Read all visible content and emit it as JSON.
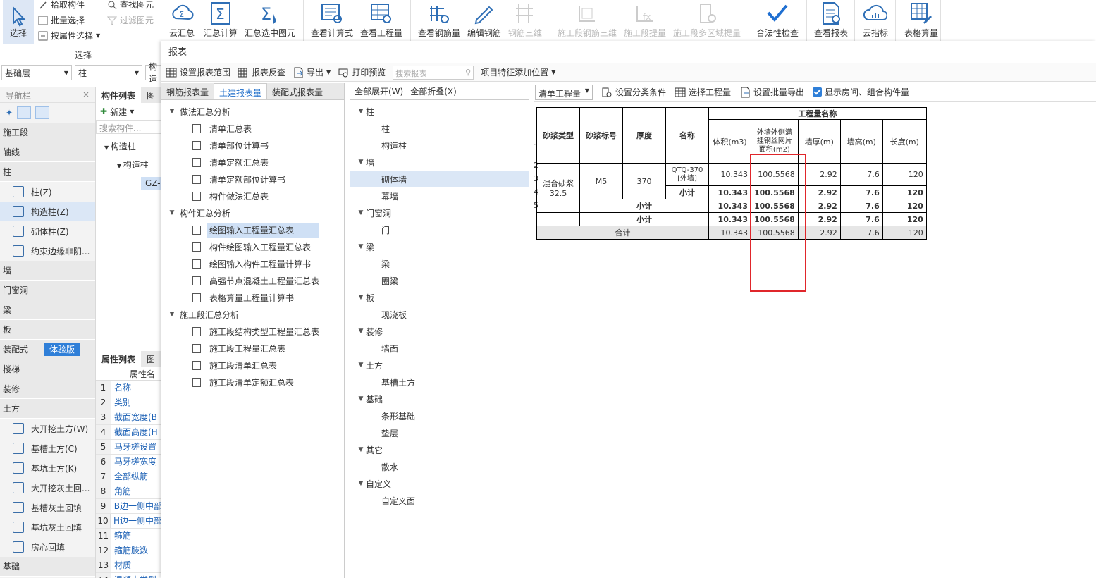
{
  "ribbon": {
    "select": {
      "label": "选择",
      "pick": "拾取构件",
      "batch": "批量选择",
      "attr": "按属性选择",
      "find": "查找图元",
      "filter": "过滤图元",
      "group": "选择"
    },
    "buttons": [
      {
        "label": "云汇总",
        "disabled": false
      },
      {
        "label": "汇总计算",
        "disabled": false
      },
      {
        "label": "汇总选中图元",
        "disabled": false
      },
      {
        "label": "查看计算式",
        "disabled": false
      },
      {
        "label": "查看工程量",
        "disabled": false
      },
      {
        "label": "查看钢筋量",
        "disabled": false
      },
      {
        "label": "编辑钢筋",
        "disabled": false
      },
      {
        "label": "钢筋三维",
        "disabled": true
      },
      {
        "label": "施工段钢筋三维",
        "disabled": true
      },
      {
        "label": "施工段提量",
        "disabled": true
      },
      {
        "label": "施工段多区域提量",
        "disabled": true
      },
      {
        "label": "合法性检查",
        "disabled": false
      },
      {
        "label": "查看报表",
        "disabled": false
      },
      {
        "label": "云指标",
        "disabled": false
      },
      {
        "label": "表格算量",
        "disabled": false
      }
    ]
  },
  "left": {
    "floor": "基础层",
    "type": "柱",
    "tab3": "构造",
    "nav_title": "导航栏",
    "nav": [
      {
        "t": "cat",
        "label": "施工段"
      },
      {
        "t": "cat",
        "label": "轴线"
      },
      {
        "t": "cat",
        "label": "柱"
      },
      {
        "t": "item",
        "label": "柱(Z)"
      },
      {
        "t": "item",
        "label": "构造柱(Z)",
        "active": true
      },
      {
        "t": "item",
        "label": "砌体柱(Z)"
      },
      {
        "t": "item",
        "label": "约束边缘非阴..."
      },
      {
        "t": "cat",
        "label": "墙"
      },
      {
        "t": "cat",
        "label": "门窗洞"
      },
      {
        "t": "cat",
        "label": "梁"
      },
      {
        "t": "cat",
        "label": "板"
      },
      {
        "t": "cat",
        "label": "装配式",
        "badge": "体验版"
      },
      {
        "t": "cat",
        "label": "楼梯"
      },
      {
        "t": "cat",
        "label": "装修"
      },
      {
        "t": "cat",
        "label": "土方"
      },
      {
        "t": "item",
        "label": "大开挖土方(W)"
      },
      {
        "t": "item",
        "label": "基槽土方(C)"
      },
      {
        "t": "item",
        "label": "基坑土方(K)"
      },
      {
        "t": "item",
        "label": "大开挖灰土回..."
      },
      {
        "t": "item",
        "label": "基槽灰土回填"
      },
      {
        "t": "item",
        "label": "基坑灰土回填"
      },
      {
        "t": "item",
        "label": "房心回填"
      },
      {
        "t": "cat",
        "label": "基础"
      }
    ],
    "comp_tab": "构件列表",
    "comp_tab2": "图",
    "new": "新建",
    "search": "搜索构件...",
    "tree": [
      "构造柱",
      "构造柱",
      "GZ-"
    ],
    "prop_tab": "属性列表",
    "prop_tab2": "图",
    "prop_hdr": "属性名",
    "props": [
      "名称",
      "类别",
      "截面宽度(B",
      "截面高度(H",
      "马牙槎设置",
      "马牙槎宽度",
      "全部纵筋",
      "角筋",
      "B边一侧中部",
      "H边一侧中部",
      "箍筋",
      "箍筋肢数",
      "材质",
      "混凝土类型"
    ]
  },
  "dialog": {
    "title": "报表",
    "toolbar": {
      "range": "设置报表范围",
      "reverse": "报表反查",
      "export": "导出",
      "preview": "打印预览",
      "search_ph": "搜索报表",
      "feature": "项目特征添加位置"
    },
    "tabs": [
      "钢筋报表量",
      "土建报表量",
      "装配式报表量"
    ],
    "tree": [
      {
        "lvl": 0,
        "label": "做法汇总分析"
      },
      {
        "lvl": 1,
        "label": "清单汇总表"
      },
      {
        "lvl": 1,
        "label": "清单部位计算书"
      },
      {
        "lvl": 1,
        "label": "清单定额汇总表"
      },
      {
        "lvl": 1,
        "label": "清单定额部位计算书"
      },
      {
        "lvl": 1,
        "label": "构件做法汇总表"
      },
      {
        "lvl": 0,
        "label": "构件汇总分析"
      },
      {
        "lvl": 1,
        "label": "绘图输入工程量汇总表",
        "sel": true
      },
      {
        "lvl": 1,
        "label": "构件绘图输入工程量汇总表"
      },
      {
        "lvl": 1,
        "label": "绘图输入构件工程量计算书"
      },
      {
        "lvl": 1,
        "label": "高强节点混凝土工程量汇总表"
      },
      {
        "lvl": 1,
        "label": "表格算量工程量计算书"
      },
      {
        "lvl": 0,
        "label": "施工段汇总分析"
      },
      {
        "lvl": 1,
        "label": "施工段结构类型工程量汇总表"
      },
      {
        "lvl": 1,
        "label": "施工段工程量汇总表"
      },
      {
        "lvl": 1,
        "label": "施工段清单汇总表"
      },
      {
        "lvl": 1,
        "label": "施工段清单定额汇总表"
      }
    ],
    "expand_all": "全部展开(W)",
    "collapse_all": "全部折叠(X)",
    "types": [
      {
        "lvl": 0,
        "label": "柱"
      },
      {
        "lvl": 1,
        "label": "柱"
      },
      {
        "lvl": 1,
        "label": "构造柱"
      },
      {
        "lvl": 0,
        "label": "墙"
      },
      {
        "lvl": 1,
        "label": "砌体墙",
        "sel": true
      },
      {
        "lvl": 1,
        "label": "幕墙"
      },
      {
        "lvl": 0,
        "label": "门窗洞"
      },
      {
        "lvl": 1,
        "label": "门"
      },
      {
        "lvl": 0,
        "label": "梁"
      },
      {
        "lvl": 1,
        "label": "梁"
      },
      {
        "lvl": 1,
        "label": "圈梁"
      },
      {
        "lvl": 0,
        "label": "板"
      },
      {
        "lvl": 1,
        "label": "现浇板"
      },
      {
        "lvl": 0,
        "label": "装修"
      },
      {
        "lvl": 1,
        "label": "墙面"
      },
      {
        "lvl": 0,
        "label": "土方"
      },
      {
        "lvl": 1,
        "label": "基槽土方"
      },
      {
        "lvl": 0,
        "label": "基础"
      },
      {
        "lvl": 1,
        "label": "条形基础"
      },
      {
        "lvl": 1,
        "label": "垫层"
      },
      {
        "lvl": 0,
        "label": "其它"
      },
      {
        "lvl": 1,
        "label": "散水"
      },
      {
        "lvl": 0,
        "label": "自定义"
      },
      {
        "lvl": 1,
        "label": "自定义面"
      }
    ],
    "report_toolbar": {
      "mode": "清单工程量",
      "classify": "设置分类条件",
      "select_proj": "选择工程量",
      "batch_export": "设置批量导出",
      "show_rooms": "显示房间、组合构件量"
    },
    "table": {
      "h_mortar_type": "砂浆类型",
      "h_mortar_grade": "砂浆标号",
      "h_thick": "厚度",
      "h_name": "名称",
      "h_group": "工程量名称",
      "h_vol": "体积(m3)",
      "h_mesh": "外墙外侧满挂钢丝网片面积(m2)",
      "h_wt": "墙厚(m)",
      "h_wh": "墙高(m)",
      "h_len": "长度(m)",
      "mortar_type": "混合砂浆32.5",
      "mortar_grade": "M5",
      "thick": "370",
      "name": "QTQ-370 [外墙]",
      "subtotal": "小计",
      "total": "合计",
      "rows": [
        [
          "10.343",
          "100.5568",
          "2.92",
          "7.6",
          "120"
        ],
        [
          "10.343",
          "100.5568",
          "2.92",
          "7.6",
          "120"
        ],
        [
          "10.343",
          "100.5568",
          "2.92",
          "7.6",
          "120"
        ],
        [
          "10.343",
          "100.5568",
          "2.92",
          "7.6",
          "120"
        ],
        [
          "10.343",
          "100.5568",
          "2.92",
          "7.6",
          "120"
        ]
      ],
      "rownums": [
        "1",
        "2",
        "3",
        "4",
        "5"
      ]
    }
  }
}
